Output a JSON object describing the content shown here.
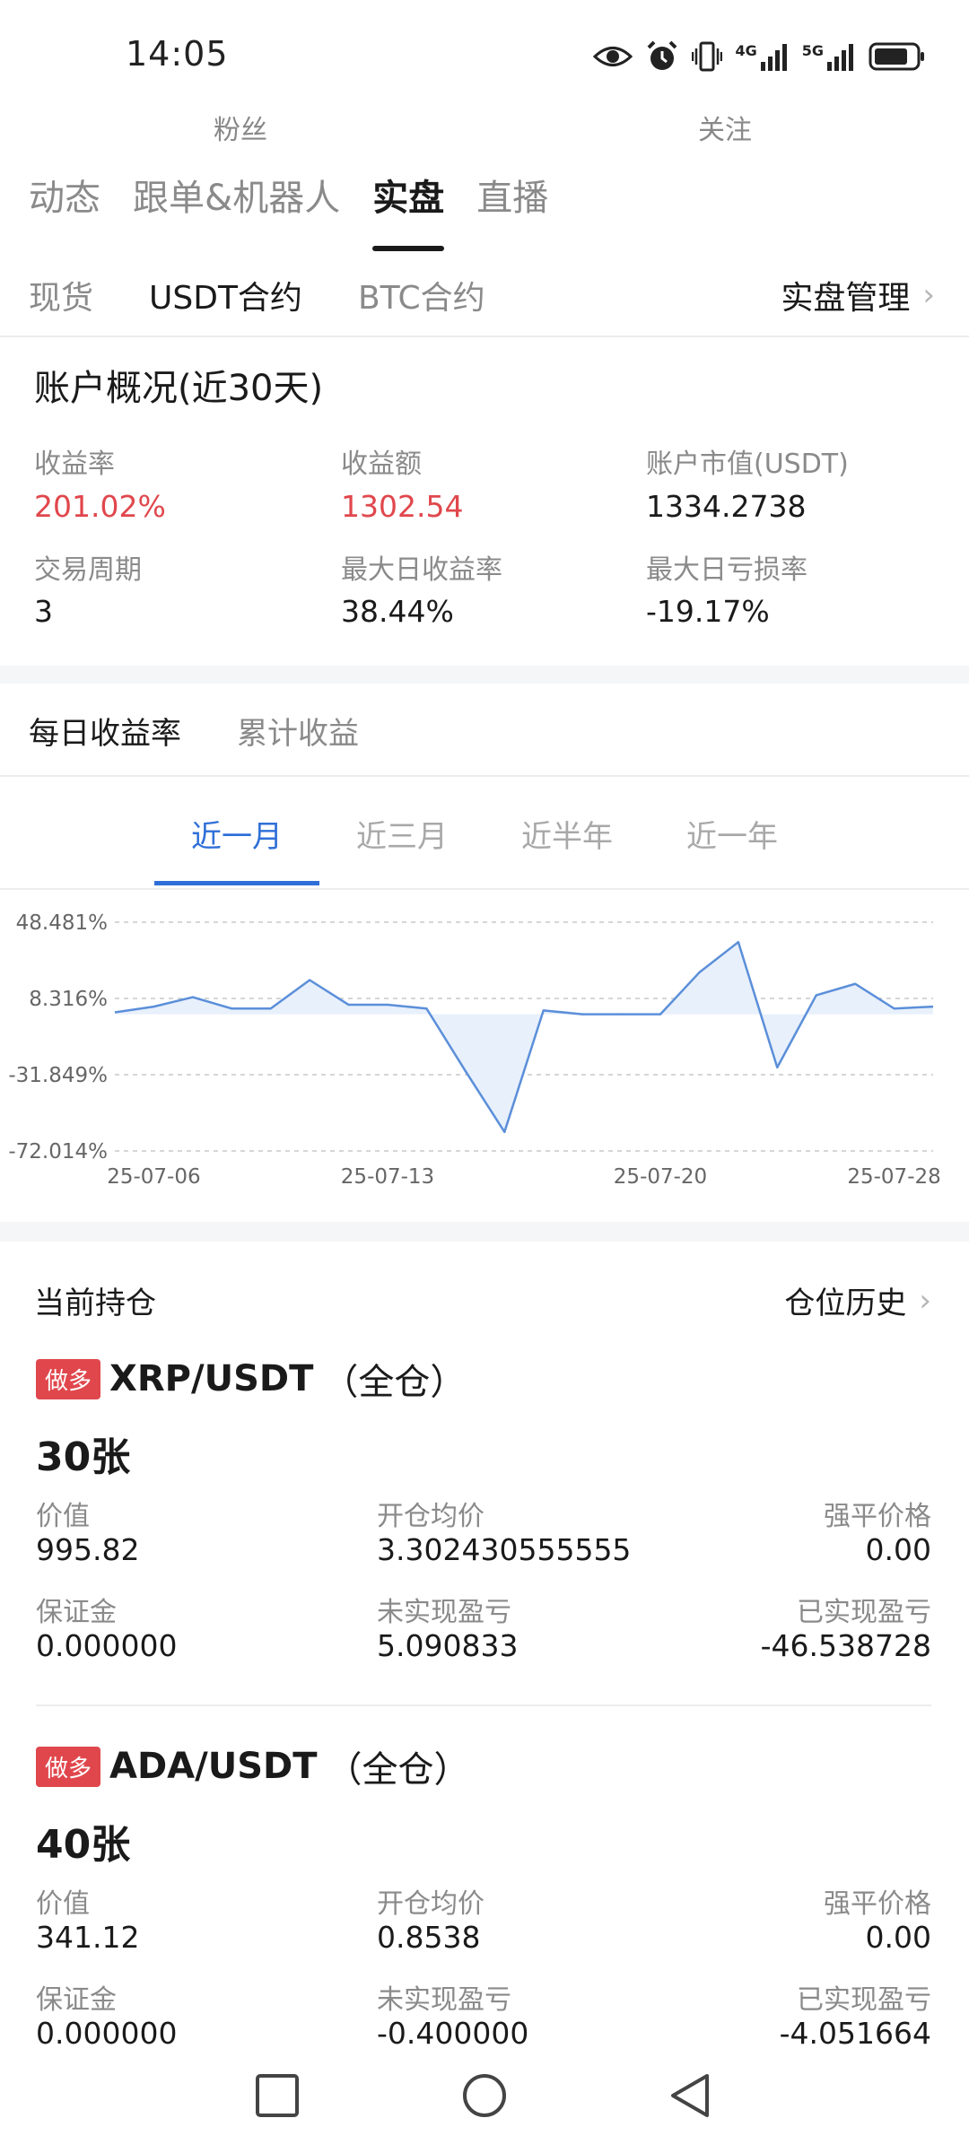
{
  "status_bar": {
    "time": "14:05",
    "icons": [
      "eye-icon",
      "alarm-icon",
      "vibrate-icon",
      "4g-signal-icon",
      "5g-signal-icon",
      "battery-icon"
    ],
    "net1": "4G",
    "net2": "5G"
  },
  "profile_stats": {
    "followers_label": "粉丝",
    "following_label": "关注"
  },
  "main_tabs": [
    "动态",
    "跟单&机器人",
    "实盘",
    "直播"
  ],
  "main_tab_active": 2,
  "sub_tabs": [
    "现货",
    "USDT合约",
    "BTC合约"
  ],
  "sub_tab_active": 1,
  "manage_label": "实盘管理",
  "overview": {
    "title": "账户概况(近30天)",
    "metrics": [
      {
        "label": "收益率",
        "value": "201.02%",
        "color": "#e0474c"
      },
      {
        "label": "收益额",
        "value": "1302.54",
        "color": "#e0474c"
      },
      {
        "label": "账户市值(USDT)",
        "value": "1334.2738"
      },
      {
        "label": "交易周期",
        "value": "3"
      },
      {
        "label": "最大日收益率",
        "value": "38.44%"
      },
      {
        "label": "最大日亏损率",
        "value": "-19.17%"
      }
    ]
  },
  "chart_tabs": [
    "每日收益率",
    "累计收益"
  ],
  "chart_tab_active": 0,
  "range_tabs": [
    "近一月",
    "近三月",
    "近半年",
    "近一年"
  ],
  "range_tab_active": 0,
  "chart_data": {
    "type": "area",
    "ytick_labels": [
      "48.481%",
      "8.316%",
      "-31.849%",
      "-72.014%"
    ],
    "yticks": [
      48.481,
      8.316,
      -31.849,
      -72.014
    ],
    "ylim": [
      -72.014,
      48.481
    ],
    "xtick_labels": [
      "25-07-06",
      "25-07-13",
      "25-07-20",
      "25-07-28"
    ],
    "xtick_index": [
      1,
      7,
      14,
      20
    ],
    "baseline": 0,
    "x": [
      "25-07-05",
      "25-07-06",
      "25-07-07",
      "25-07-08",
      "25-07-09",
      "25-07-10",
      "25-07-11",
      "25-07-12",
      "25-07-13",
      "25-07-14",
      "25-07-15",
      "25-07-16",
      "25-07-17",
      "25-07-18",
      "25-07-19",
      "25-07-20",
      "25-07-21",
      "25-07-22",
      "25-07-23",
      "25-07-24",
      "25-07-25",
      "25-07-26",
      "25-07-27"
    ],
    "values": [
      1,
      4,
      9,
      3,
      3,
      18,
      5,
      5,
      3,
      -30,
      -62,
      2,
      0,
      0,
      0,
      22,
      38,
      -28,
      10,
      16,
      3,
      4
    ],
    "line_color": "#5b8fd9",
    "fill_color": "#e8f0fc"
  },
  "positions_header": "当前持仓",
  "positions_history": "仓位历史",
  "positions": [
    {
      "side": "做多",
      "pair": "XRP/USDT",
      "mode": "（全仓）",
      "qty": "30张",
      "fields": [
        {
          "label": "价值",
          "value": "995.82"
        },
        {
          "label": "开仓均价",
          "value": "3.302430555555"
        },
        {
          "label": "强平价格",
          "value": "0.00"
        },
        {
          "label": "保证金",
          "value": "0.000000"
        },
        {
          "label": "未实现盈亏",
          "value": "5.090833"
        },
        {
          "label": "已实现盈亏",
          "value": "-46.538728"
        }
      ]
    },
    {
      "side": "做多",
      "pair": "ADA/USDT",
      "mode": "（全仓）",
      "qty": "40张",
      "fields": [
        {
          "label": "价值",
          "value": "341.12"
        },
        {
          "label": "开仓均价",
          "value": "0.8538"
        },
        {
          "label": "强平价格",
          "value": "0.00"
        },
        {
          "label": "保证金",
          "value": "0.000000"
        },
        {
          "label": "未实现盈亏",
          "value": "-0.400000"
        },
        {
          "label": "已实现盈亏",
          "value": "-4.051664"
        }
      ]
    }
  ],
  "nav_bar": [
    "recents-square-icon",
    "home-circle-icon",
    "back-triangle-icon"
  ]
}
